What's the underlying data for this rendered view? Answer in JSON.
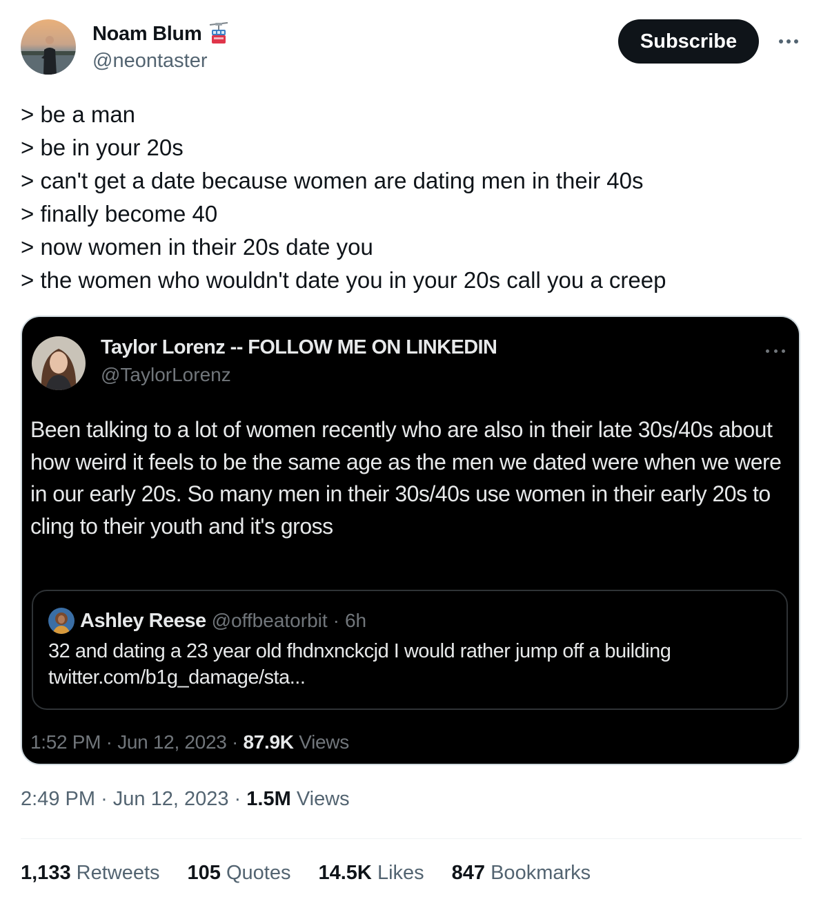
{
  "author": {
    "name": "Noam Blum",
    "handle": "@neontaster",
    "badge_icon": "aerial-tramway-icon"
  },
  "subscribe_label": "Subscribe",
  "tweet": {
    "lines": [
      "> be a man",
      "> be in your 20s",
      "> can't get a date because women are dating men in their 40s",
      "> finally become 40",
      "> now women in their 20s date you",
      "> the women who wouldn't date you in your 20s call you a creep"
    ],
    "time": "2:49 PM",
    "date": "Jun 12, 2023",
    "views_count": "1.5M",
    "views_label": "Views"
  },
  "quoted": {
    "name": "Taylor Lorenz -- FOLLOW ME ON LINKEDIN",
    "handle": "@TaylorLorenz",
    "text": "Been talking to a lot of women recently who are also in their late 30s/40s about how weird it feels to be the same age as the men we dated were when we were in our early 20s. So many men in their 30s/40s use women in their early 20s to cling to their youth and it's gross",
    "nested": {
      "name": "Ashley Reese",
      "handle": "@offbeatorbit",
      "age": "6h",
      "text_line1": "32 and dating a 23 year old fhdnxnckcjd I would rather jump off a building",
      "text_line2": "twitter.com/b1g_damage/sta..."
    },
    "time": "1:52 PM",
    "date": "Jun 12, 2023",
    "views_count": "87.9K",
    "views_label": "Views"
  },
  "stats": {
    "retweets_count": "1,133",
    "retweets_label": "Retweets",
    "quotes_count": "105",
    "quotes_label": "Quotes",
    "likes_count": "14.5K",
    "likes_label": "Likes",
    "bookmarks_count": "847",
    "bookmarks_label": "Bookmarks"
  },
  "colors": {
    "text": "#0f1419",
    "secondary": "#536471",
    "button_bg": "#0f1419",
    "quote_bg": "#000000"
  }
}
